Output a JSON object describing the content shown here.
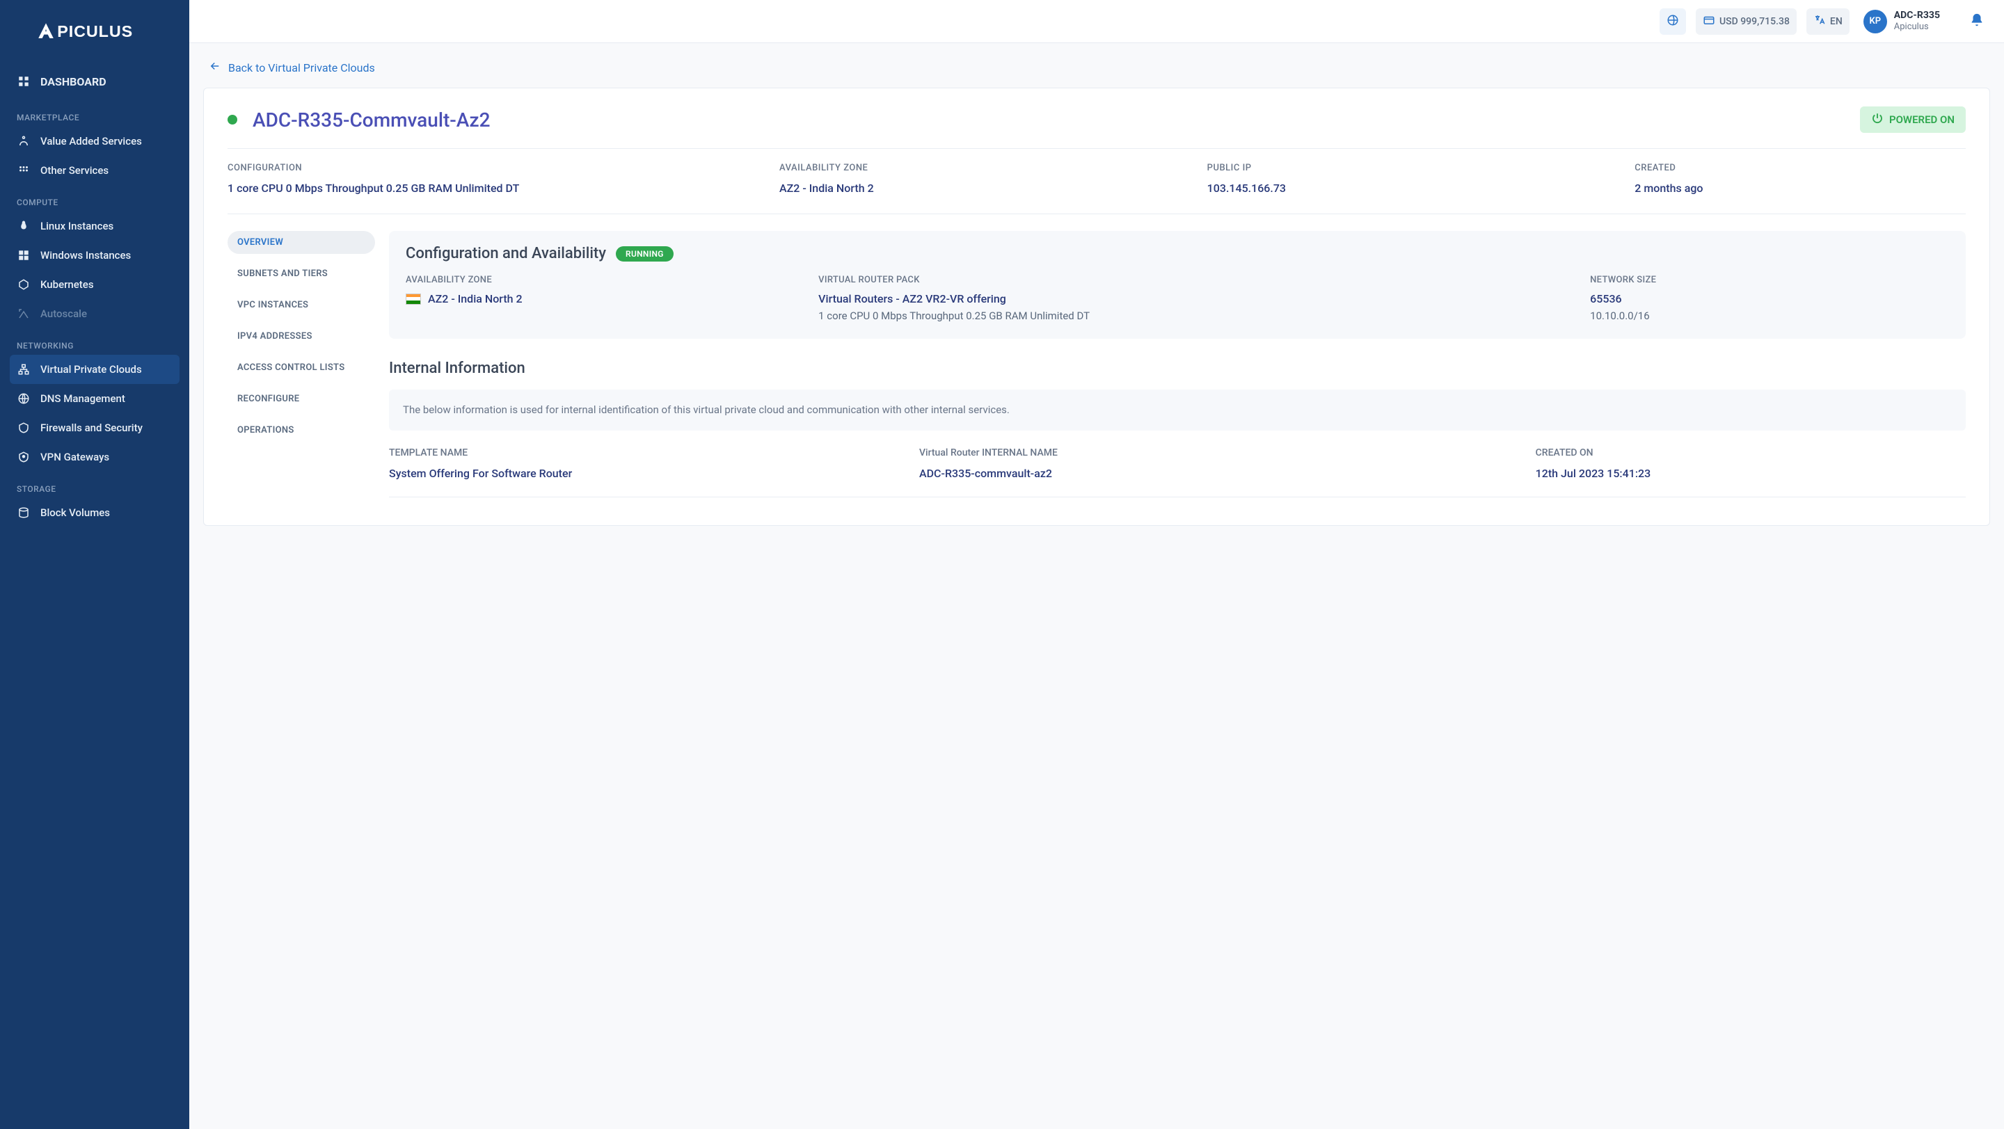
{
  "brand": "APICULUS",
  "topbar": {
    "balance": "USD 999,715.38",
    "language": "EN",
    "avatar_initials": "KP",
    "user_line1": "ADC-R335",
    "user_line2": "Apiculus"
  },
  "sidebar": {
    "dashboard": "DASHBOARD",
    "sections": [
      {
        "title": "MARKETPLACE",
        "items": [
          {
            "label": "Value Added Services"
          },
          {
            "label": "Other Services"
          }
        ]
      },
      {
        "title": "COMPUTE",
        "items": [
          {
            "label": "Linux Instances"
          },
          {
            "label": "Windows Instances"
          },
          {
            "label": "Kubernetes"
          },
          {
            "label": "Autoscale",
            "muted": true
          }
        ]
      },
      {
        "title": "NETWORKING",
        "items": [
          {
            "label": "Virtual Private Clouds",
            "active": true
          },
          {
            "label": "DNS Management"
          },
          {
            "label": "Firewalls and Security"
          },
          {
            "label": "VPN Gateways"
          }
        ]
      },
      {
        "title": "STORAGE",
        "items": [
          {
            "label": "Block Volumes"
          }
        ]
      }
    ]
  },
  "back_link": "Back to Virtual Private Clouds",
  "page_title": "ADC-R335-Commvault-Az2",
  "power_status": "POWERED ON",
  "summary": {
    "configuration_label": "CONFIGURATION",
    "configuration_value": "1 core CPU 0 Mbps Throughput 0.25 GB RAM Unlimited DT",
    "az_label": "AVAILABILITY ZONE",
    "az_value": "AZ2 - India North 2",
    "public_ip_label": "PUBLIC IP",
    "public_ip_value": "103.145.166.73",
    "created_label": "CREATED",
    "created_value": "2 months ago"
  },
  "subnav": [
    "OVERVIEW",
    "SUBNETS AND TIERS",
    "VPC INSTANCES",
    "IPV4 ADDRESSES",
    "ACCESS CONTROL LISTS",
    "RECONFIGURE",
    "OPERATIONS"
  ],
  "config_panel": {
    "title": "Configuration and Availability",
    "status_pill": "RUNNING",
    "az_label": "AVAILABILITY ZONE",
    "az_value": "AZ2 - India North 2",
    "vrp_label": "VIRTUAL ROUTER PACK",
    "vrp_value": "Virtual Routers - AZ2 VR2-VR offering",
    "vrp_sub": "1 core CPU 0 Mbps Throughput 0.25 GB RAM Unlimited DT",
    "ns_label": "NETWORK SIZE",
    "ns_value": "65536",
    "ns_sub": "10.10.0.0/16"
  },
  "internal": {
    "title": "Internal Information",
    "info_text": "The below information is used for internal identification of this virtual private cloud and communication with other internal services.",
    "template_label": "TEMPLATE NAME",
    "template_value": "System Offering For Software Router",
    "vr_label": "Virtual Router INTERNAL NAME",
    "vr_value": "ADC-R335-commvault-az2",
    "created_label": "CREATED ON",
    "created_value": "12th Jul 2023 15:41:23"
  }
}
